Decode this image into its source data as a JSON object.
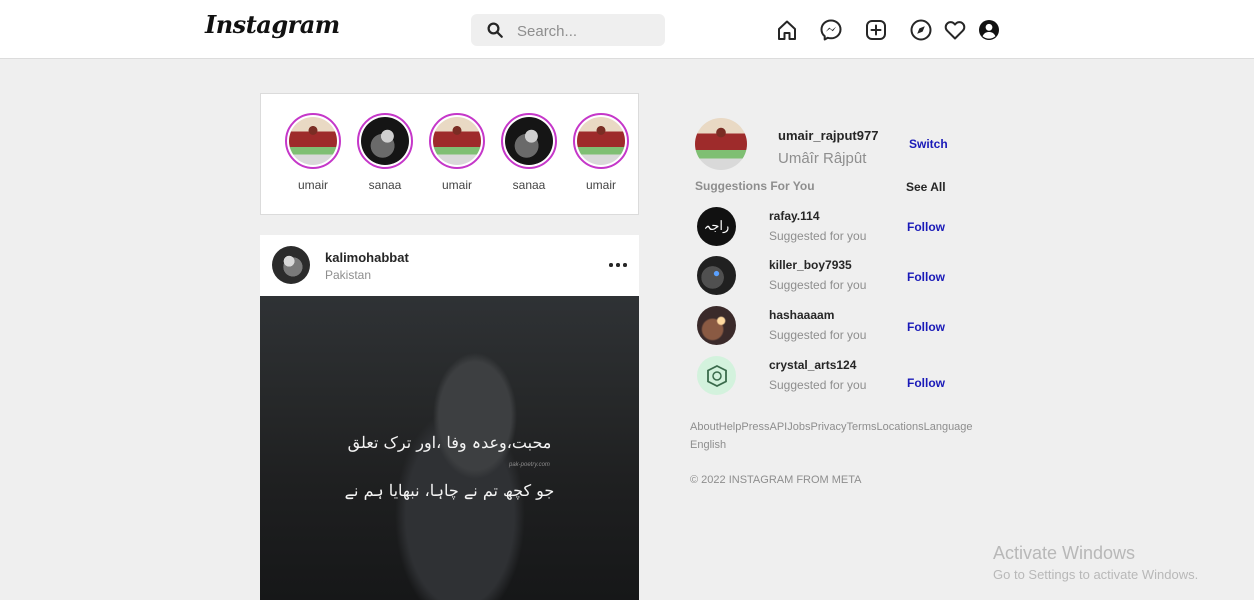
{
  "header": {
    "logo": "Instagram",
    "search_placeholder": "Search..."
  },
  "stories": [
    {
      "name": "umair",
      "avatar": "umair"
    },
    {
      "name": "sanaa",
      "avatar": "sanaa"
    },
    {
      "name": "umair",
      "avatar": "umair"
    },
    {
      "name": "sanaa",
      "avatar": "sanaa"
    },
    {
      "name": "umair",
      "avatar": "umair"
    }
  ],
  "post": {
    "username": "kalimohabbat",
    "location": "Pakistan",
    "image_text_line1": "محبت،وعدہ وفا ،اور ترک تعلق",
    "image_text_line2": "جو کچھ تم نے چاہا، نبھایا ہم نے",
    "image_watermark": "pak-poetry.com"
  },
  "sidebar": {
    "username": "umair_rajput977",
    "full_name": "Umâîr Râjpût",
    "switch_label": "Switch",
    "suggestions_title": "Suggestions For You",
    "see_all_label": "See All",
    "suggestions": [
      {
        "username": "rafay.114",
        "subtitle": "Suggested for you",
        "action": "Follow"
      },
      {
        "username": "killer_boy7935",
        "subtitle": "Suggested for you",
        "action": "Follow"
      },
      {
        "username": "hashaaaam",
        "subtitle": "Suggested for you",
        "action": "Follow"
      },
      {
        "username": "crystal_arts124",
        "subtitle": "Suggested for you",
        "action": "Follow"
      }
    ],
    "footer_links": [
      "About",
      "Help",
      "Press",
      "API",
      "Jobs",
      "Privacy",
      "Terms",
      "Locations",
      "Language"
    ],
    "footer_language": "English",
    "copyright": "© 2022 INSTAGRAM FROM META"
  },
  "os_watermark": {
    "title": "Activate Windows",
    "subtitle": "Go to Settings to activate Windows."
  },
  "colors": {
    "link_blue": "#1a1ab8",
    "story_ring": "#c537c9",
    "page_bg": "#efefef"
  }
}
